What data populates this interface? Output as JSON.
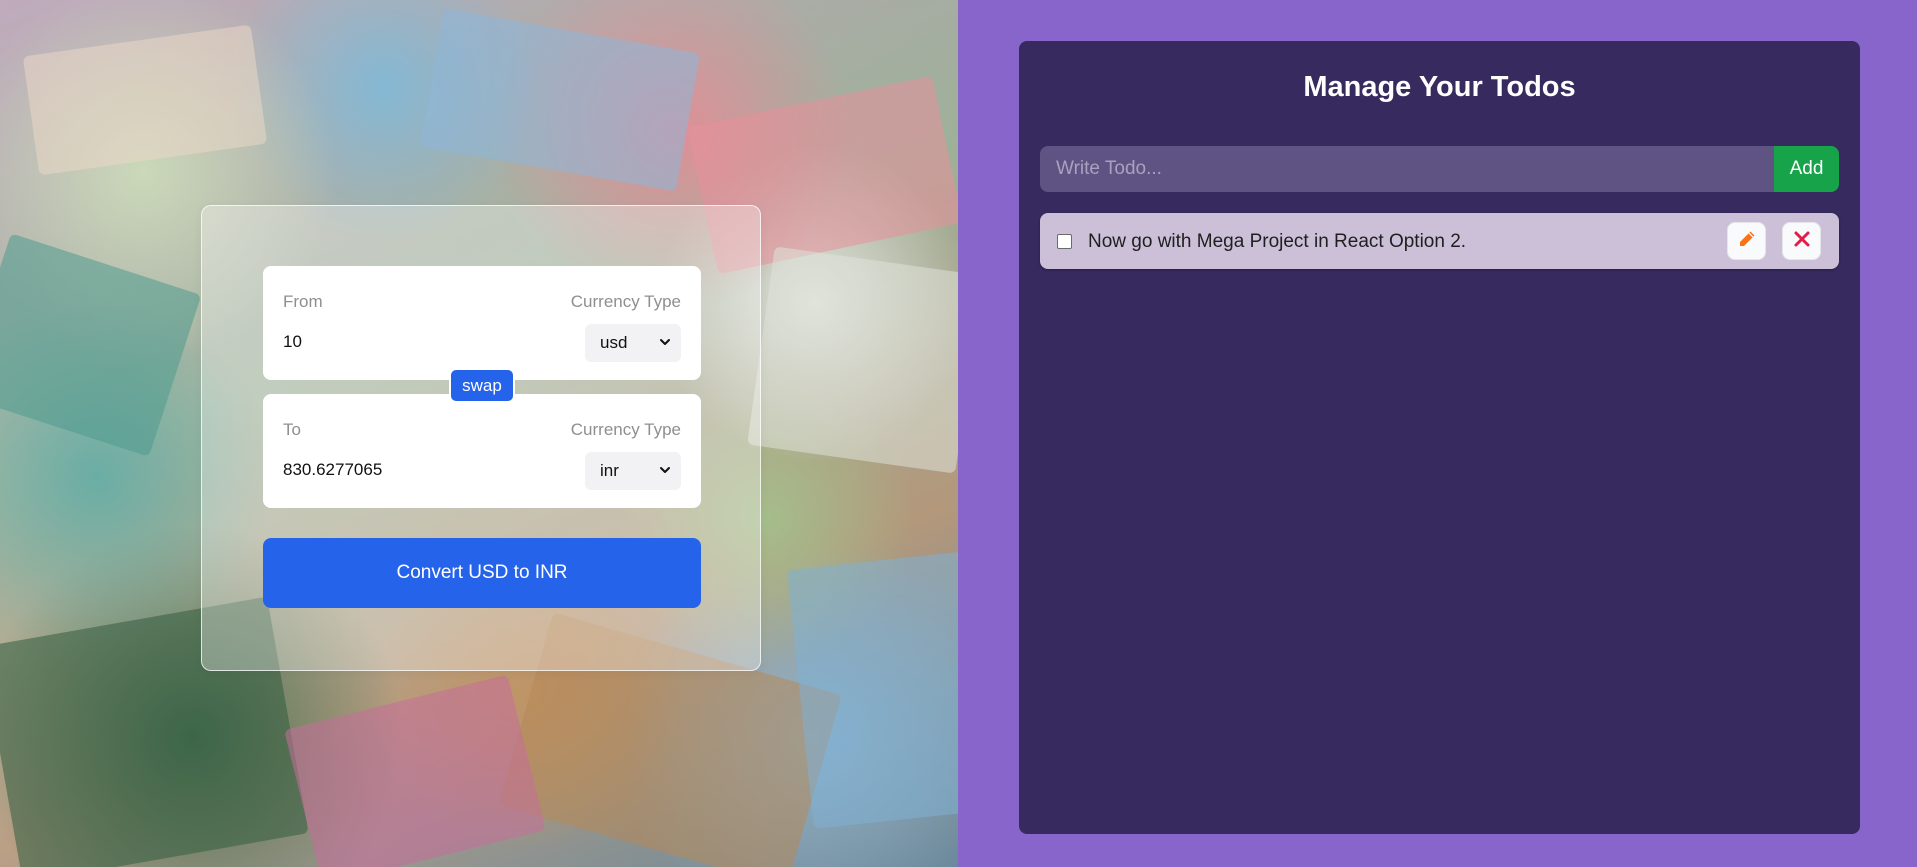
{
  "converter": {
    "from": {
      "label": "From",
      "currency_type_label": "Currency Type",
      "amount": "10",
      "currency": "usd"
    },
    "to": {
      "label": "To",
      "currency_type_label": "Currency Type",
      "amount": "830.6277065",
      "currency": "inr"
    },
    "swap_label": "swap",
    "convert_label": "Convert USD to INR"
  },
  "todos": {
    "title": "Manage Your Todos",
    "input_placeholder": "Write Todo...",
    "add_label": "Add",
    "items": [
      {
        "text": "Now go with Mega Project in React Option 2.",
        "completed": false
      }
    ]
  },
  "icons": {
    "edit": "pencil-icon",
    "delete": "close-icon",
    "select": "chevron-down-icon"
  },
  "colors": {
    "accent_blue": "#2563eb",
    "add_green": "#16a34a",
    "page_purple": "#8765cb",
    "panel_dark": "#362a5e",
    "todo_item_bg": "#ccc0d9",
    "delete_red": "#e11d48",
    "edit_orange": "#f97316"
  }
}
